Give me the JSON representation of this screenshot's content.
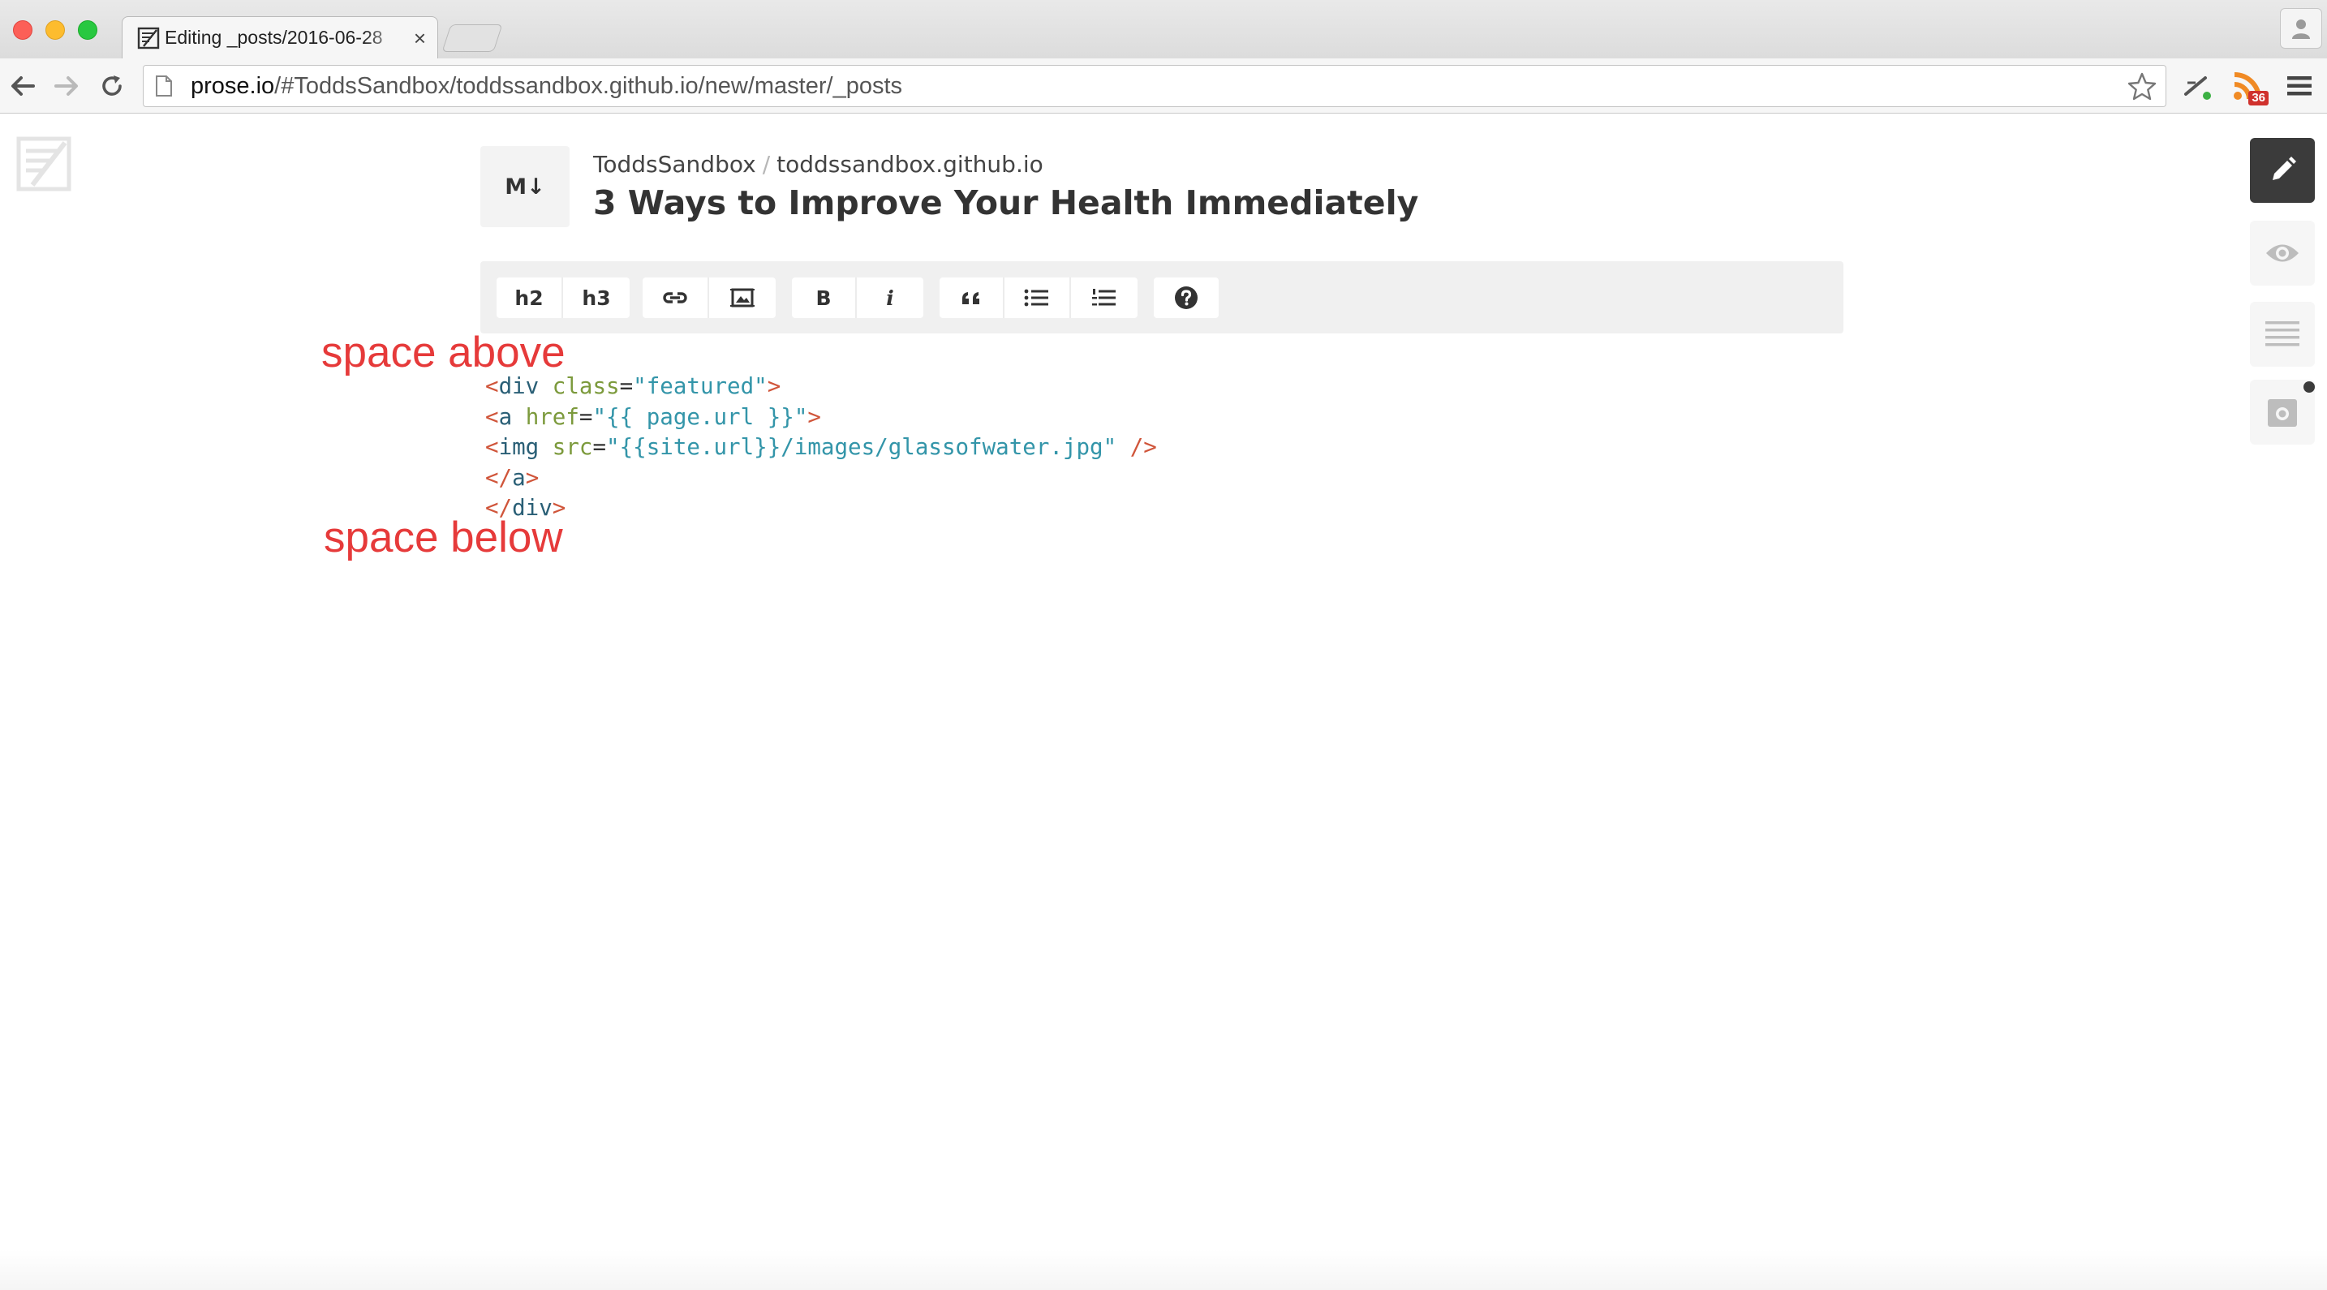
{
  "browser": {
    "tab": {
      "title": "Editing _posts/2016-06-28",
      "close_label": "×"
    },
    "address": {
      "host": "prose.io",
      "path": "/#ToddsSandbox/toddssandbox.github.io/new/master/_posts"
    },
    "extensions": {
      "rss_badge": "36"
    },
    "icons": [
      "back-arrow-icon",
      "forward-arrow-icon",
      "reload-icon",
      "page-icon",
      "star-icon",
      "wand-icon",
      "rss-icon",
      "hamburger-menu-icon",
      "profile-icon"
    ]
  },
  "prose": {
    "format_badge": "M↓",
    "breadcrumb": {
      "owner": "ToddsSandbox",
      "separator": "/",
      "repo": "toddssandbox.github.io"
    },
    "title": "3 Ways to Improve Your Health Immediately",
    "toolbar": {
      "h2": "h2",
      "h3": "h3",
      "bold": "B",
      "italic": "i"
    },
    "code_lines": [
      [
        {
          "c": "p",
          "t": "<"
        },
        {
          "c": "t",
          "t": "div"
        },
        {
          "c": "",
          "t": " "
        },
        {
          "c": "a",
          "t": "class"
        },
        {
          "c": "",
          "t": "="
        },
        {
          "c": "v",
          "t": "\"featured\""
        },
        {
          "c": "p",
          "t": ">"
        }
      ],
      [
        {
          "c": "p",
          "t": "<"
        },
        {
          "c": "t",
          "t": "a"
        },
        {
          "c": "",
          "t": " "
        },
        {
          "c": "a",
          "t": "href"
        },
        {
          "c": "",
          "t": "="
        },
        {
          "c": "v",
          "t": "\"{{ page.url }}\""
        },
        {
          "c": "p",
          "t": ">"
        }
      ],
      [
        {
          "c": "p",
          "t": "<"
        },
        {
          "c": "t",
          "t": "img"
        },
        {
          "c": "",
          "t": " "
        },
        {
          "c": "a",
          "t": "src"
        },
        {
          "c": "",
          "t": "="
        },
        {
          "c": "v",
          "t": "\"{{site.url}}/images/glassofwater.jpg\""
        },
        {
          "c": "",
          "t": " "
        },
        {
          "c": "p",
          "t": "/>"
        }
      ],
      [
        {
          "c": "p",
          "t": "</"
        },
        {
          "c": "t",
          "t": "a"
        },
        {
          "c": "p",
          "t": ">"
        }
      ],
      [
        {
          "c": "p",
          "t": "</"
        },
        {
          "c": "t",
          "t": "div"
        },
        {
          "c": "p",
          "t": ">"
        }
      ]
    ],
    "sidebar": [
      "edit-pencil-icon",
      "preview-eye-icon",
      "metadata-list-icon",
      "media-camera-icon"
    ]
  },
  "annotations": {
    "above": "space above",
    "below": "space below"
  },
  "colors": {
    "annotation": "#e63a3a",
    "active_sidebar": "#3b3b3b",
    "tag": "#2a5f76",
    "punct": "#d0553a",
    "attr": "#7c9a3c",
    "value": "#3395a9"
  }
}
